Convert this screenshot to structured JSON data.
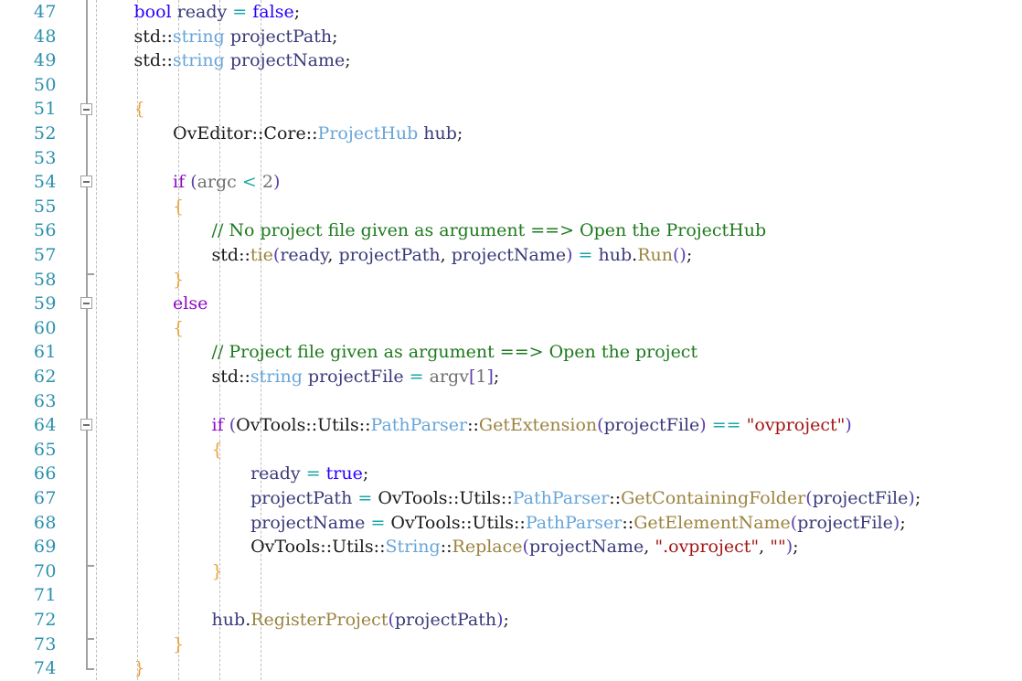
{
  "editor": {
    "name": "code-editor",
    "language": "cpp",
    "background": "#ffffff",
    "first_line": 47,
    "last_line": 74,
    "line_height": 26.6,
    "char_width": 10.63,
    "colors": {
      "line_number": "#2b91af",
      "keyword": "#8f08c4",
      "type": "#2b00ff",
      "class_type": "#68a5d8",
      "function": "#9b8340",
      "comment": "#1d7a1d",
      "string": "#a31515",
      "operator": "#1aa7a7",
      "brace": "#e8a33d",
      "paren": "#5c3fb0",
      "identifier": "#3a3a7a",
      "dim": "#6f6f6f",
      "fold_line": "#a0a0a0",
      "indent_guide": "#bfbfbf"
    }
  },
  "indent_guides_x": [
    105,
    150,
    195,
    240,
    285
  ],
  "lines": [
    {
      "n": 47,
      "indent": 4,
      "fold": "line",
      "tokens": [
        {
          "t": "bool",
          "c": "tok-type"
        },
        {
          "t": " ",
          "c": "tok-plain"
        },
        {
          "t": "ready",
          "c": "tok-id"
        },
        {
          "t": " ",
          "c": "tok-plain"
        },
        {
          "t": "=",
          "c": "tok-op"
        },
        {
          "t": " ",
          "c": "tok-plain"
        },
        {
          "t": "false",
          "c": "tok-type"
        },
        {
          "t": ";",
          "c": "tok-plain"
        }
      ]
    },
    {
      "n": 48,
      "indent": 4,
      "fold": "line",
      "tokens": [
        {
          "t": "std",
          "c": "tok-plain"
        },
        {
          "t": "::",
          "c": "tok-plain"
        },
        {
          "t": "string",
          "c": "tok-class"
        },
        {
          "t": " ",
          "c": "tok-plain"
        },
        {
          "t": "projectPath",
          "c": "tok-id"
        },
        {
          "t": ";",
          "c": "tok-plain"
        }
      ]
    },
    {
      "n": 49,
      "indent": 4,
      "fold": "line",
      "tokens": [
        {
          "t": "std",
          "c": "tok-plain"
        },
        {
          "t": "::",
          "c": "tok-plain"
        },
        {
          "t": "string",
          "c": "tok-class"
        },
        {
          "t": " ",
          "c": "tok-plain"
        },
        {
          "t": "projectName",
          "c": "tok-id"
        },
        {
          "t": ";",
          "c": "tok-plain"
        }
      ]
    },
    {
      "n": 50,
      "indent": 0,
      "fold": "line",
      "tokens": []
    },
    {
      "n": 51,
      "indent": 4,
      "fold": "box",
      "tokens": [
        {
          "t": "{",
          "c": "tok-brace"
        }
      ]
    },
    {
      "n": 52,
      "indent": 8,
      "fold": "line",
      "tokens": [
        {
          "t": "OvEditor",
          "c": "tok-plain"
        },
        {
          "t": "::",
          "c": "tok-plain"
        },
        {
          "t": "Core",
          "c": "tok-plain"
        },
        {
          "t": "::",
          "c": "tok-plain"
        },
        {
          "t": "ProjectHub",
          "c": "tok-class"
        },
        {
          "t": " ",
          "c": "tok-plain"
        },
        {
          "t": "hub",
          "c": "tok-id"
        },
        {
          "t": ";",
          "c": "tok-plain"
        }
      ]
    },
    {
      "n": 53,
      "indent": 0,
      "fold": "line",
      "tokens": []
    },
    {
      "n": 54,
      "indent": 8,
      "fold": "box",
      "tokens": [
        {
          "t": "if",
          "c": "tok-kw"
        },
        {
          "t": " ",
          "c": "tok-plain"
        },
        {
          "t": "(",
          "c": "tok-paren"
        },
        {
          "t": "argc",
          "c": "tok-dim"
        },
        {
          "t": " ",
          "c": "tok-plain"
        },
        {
          "t": "<",
          "c": "tok-op"
        },
        {
          "t": " ",
          "c": "tok-plain"
        },
        {
          "t": "2",
          "c": "tok-dim"
        },
        {
          "t": ")",
          "c": "tok-paren"
        }
      ]
    },
    {
      "n": 55,
      "indent": 8,
      "fold": "line",
      "tokens": [
        {
          "t": "{",
          "c": "tok-brace"
        }
      ]
    },
    {
      "n": 56,
      "indent": 12,
      "fold": "line",
      "tokens": [
        {
          "t": "// No project file given as argument ==> Open the ProjectHub",
          "c": "tok-comment"
        }
      ]
    },
    {
      "n": 57,
      "indent": 12,
      "fold": "line",
      "tokens": [
        {
          "t": "std",
          "c": "tok-plain"
        },
        {
          "t": "::",
          "c": "tok-plain"
        },
        {
          "t": "tie",
          "c": "tok-fn"
        },
        {
          "t": "(",
          "c": "tok-paren"
        },
        {
          "t": "ready",
          "c": "tok-id"
        },
        {
          "t": ", ",
          "c": "tok-plain"
        },
        {
          "t": "projectPath",
          "c": "tok-id"
        },
        {
          "t": ", ",
          "c": "tok-plain"
        },
        {
          "t": "projectName",
          "c": "tok-id"
        },
        {
          "t": ")",
          "c": "tok-paren"
        },
        {
          "t": " ",
          "c": "tok-plain"
        },
        {
          "t": "=",
          "c": "tok-op"
        },
        {
          "t": " ",
          "c": "tok-plain"
        },
        {
          "t": "hub",
          "c": "tok-id"
        },
        {
          "t": ".",
          "c": "tok-plain"
        },
        {
          "t": "Run",
          "c": "tok-fn"
        },
        {
          "t": "(",
          "c": "tok-paren"
        },
        {
          "t": ")",
          "c": "tok-paren"
        },
        {
          "t": ";",
          "c": "tok-plain"
        }
      ]
    },
    {
      "n": 58,
      "indent": 8,
      "fold": "line-endfoot",
      "tokens": [
        {
          "t": "}",
          "c": "tok-brace"
        }
      ]
    },
    {
      "n": 59,
      "indent": 8,
      "fold": "box",
      "tokens": [
        {
          "t": "else",
          "c": "tok-kw"
        }
      ]
    },
    {
      "n": 60,
      "indent": 8,
      "fold": "line",
      "tokens": [
        {
          "t": "{",
          "c": "tok-brace"
        }
      ]
    },
    {
      "n": 61,
      "indent": 12,
      "fold": "line",
      "tokens": [
        {
          "t": "// Project file given as argument ==> Open the project",
          "c": "tok-comment"
        }
      ]
    },
    {
      "n": 62,
      "indent": 12,
      "fold": "line",
      "tokens": [
        {
          "t": "std",
          "c": "tok-plain"
        },
        {
          "t": "::",
          "c": "tok-plain"
        },
        {
          "t": "string",
          "c": "tok-class"
        },
        {
          "t": " ",
          "c": "tok-plain"
        },
        {
          "t": "projectFile",
          "c": "tok-id"
        },
        {
          "t": " ",
          "c": "tok-plain"
        },
        {
          "t": "=",
          "c": "tok-op"
        },
        {
          "t": " ",
          "c": "tok-plain"
        },
        {
          "t": "argv",
          "c": "tok-dim"
        },
        {
          "t": "[",
          "c": "tok-paren"
        },
        {
          "t": "1",
          "c": "tok-dim"
        },
        {
          "t": "]",
          "c": "tok-paren"
        },
        {
          "t": ";",
          "c": "tok-plain"
        }
      ]
    },
    {
      "n": 63,
      "indent": 0,
      "fold": "line",
      "tokens": []
    },
    {
      "n": 64,
      "indent": 12,
      "fold": "box",
      "tokens": [
        {
          "t": "if",
          "c": "tok-kw"
        },
        {
          "t": " ",
          "c": "tok-plain"
        },
        {
          "t": "(",
          "c": "tok-paren"
        },
        {
          "t": "OvTools",
          "c": "tok-plain"
        },
        {
          "t": "::",
          "c": "tok-plain"
        },
        {
          "t": "Utils",
          "c": "tok-plain"
        },
        {
          "t": "::",
          "c": "tok-plain"
        },
        {
          "t": "PathParser",
          "c": "tok-class"
        },
        {
          "t": "::",
          "c": "tok-plain"
        },
        {
          "t": "GetExtension",
          "c": "tok-fn"
        },
        {
          "t": "(",
          "c": "tok-paren"
        },
        {
          "t": "projectFile",
          "c": "tok-id"
        },
        {
          "t": ")",
          "c": "tok-paren"
        },
        {
          "t": " ",
          "c": "tok-plain"
        },
        {
          "t": "==",
          "c": "tok-op"
        },
        {
          "t": " ",
          "c": "tok-plain"
        },
        {
          "t": "\"ovproject\"",
          "c": "tok-str"
        },
        {
          "t": ")",
          "c": "tok-paren"
        }
      ]
    },
    {
      "n": 65,
      "indent": 12,
      "fold": "line",
      "tokens": [
        {
          "t": "{",
          "c": "tok-brace"
        }
      ]
    },
    {
      "n": 66,
      "indent": 16,
      "fold": "line",
      "tokens": [
        {
          "t": "ready",
          "c": "tok-id"
        },
        {
          "t": " ",
          "c": "tok-plain"
        },
        {
          "t": "=",
          "c": "tok-op"
        },
        {
          "t": " ",
          "c": "tok-plain"
        },
        {
          "t": "true",
          "c": "tok-type"
        },
        {
          "t": ";",
          "c": "tok-plain"
        }
      ]
    },
    {
      "n": 67,
      "indent": 16,
      "fold": "line",
      "tokens": [
        {
          "t": "projectPath",
          "c": "tok-id"
        },
        {
          "t": " ",
          "c": "tok-plain"
        },
        {
          "t": "=",
          "c": "tok-op"
        },
        {
          "t": " ",
          "c": "tok-plain"
        },
        {
          "t": "OvTools",
          "c": "tok-plain"
        },
        {
          "t": "::",
          "c": "tok-plain"
        },
        {
          "t": "Utils",
          "c": "tok-plain"
        },
        {
          "t": "::",
          "c": "tok-plain"
        },
        {
          "t": "PathParser",
          "c": "tok-class"
        },
        {
          "t": "::",
          "c": "tok-plain"
        },
        {
          "t": "GetContainingFolder",
          "c": "tok-fn"
        },
        {
          "t": "(",
          "c": "tok-paren"
        },
        {
          "t": "projectFile",
          "c": "tok-id"
        },
        {
          "t": ")",
          "c": "tok-paren"
        },
        {
          "t": ";",
          "c": "tok-plain"
        }
      ]
    },
    {
      "n": 68,
      "indent": 16,
      "fold": "line",
      "tokens": [
        {
          "t": "projectName",
          "c": "tok-id"
        },
        {
          "t": " ",
          "c": "tok-plain"
        },
        {
          "t": "=",
          "c": "tok-op"
        },
        {
          "t": " ",
          "c": "tok-plain"
        },
        {
          "t": "OvTools",
          "c": "tok-plain"
        },
        {
          "t": "::",
          "c": "tok-plain"
        },
        {
          "t": "Utils",
          "c": "tok-plain"
        },
        {
          "t": "::",
          "c": "tok-plain"
        },
        {
          "t": "PathParser",
          "c": "tok-class"
        },
        {
          "t": "::",
          "c": "tok-plain"
        },
        {
          "t": "GetElementName",
          "c": "tok-fn"
        },
        {
          "t": "(",
          "c": "tok-paren"
        },
        {
          "t": "projectFile",
          "c": "tok-id"
        },
        {
          "t": ")",
          "c": "tok-paren"
        },
        {
          "t": ";",
          "c": "tok-plain"
        }
      ]
    },
    {
      "n": 69,
      "indent": 16,
      "fold": "line",
      "tokens": [
        {
          "t": "OvTools",
          "c": "tok-plain"
        },
        {
          "t": "::",
          "c": "tok-plain"
        },
        {
          "t": "Utils",
          "c": "tok-plain"
        },
        {
          "t": "::",
          "c": "tok-plain"
        },
        {
          "t": "String",
          "c": "tok-class"
        },
        {
          "t": "::",
          "c": "tok-plain"
        },
        {
          "t": "Replace",
          "c": "tok-fn"
        },
        {
          "t": "(",
          "c": "tok-paren"
        },
        {
          "t": "projectName",
          "c": "tok-id"
        },
        {
          "t": ", ",
          "c": "tok-plain"
        },
        {
          "t": "\".ovproject\"",
          "c": "tok-str"
        },
        {
          "t": ", ",
          "c": "tok-plain"
        },
        {
          "t": "\"\"",
          "c": "tok-str"
        },
        {
          "t": ")",
          "c": "tok-paren"
        },
        {
          "t": ";",
          "c": "tok-plain"
        }
      ]
    },
    {
      "n": 70,
      "indent": 12,
      "fold": "line-endfoot",
      "tokens": [
        {
          "t": "}",
          "c": "tok-brace"
        }
      ]
    },
    {
      "n": 71,
      "indent": 0,
      "fold": "line",
      "tokens": []
    },
    {
      "n": 72,
      "indent": 12,
      "fold": "line",
      "tokens": [
        {
          "t": "hub",
          "c": "tok-id"
        },
        {
          "t": ".",
          "c": "tok-plain"
        },
        {
          "t": "RegisterProject",
          "c": "tok-fn"
        },
        {
          "t": "(",
          "c": "tok-paren"
        },
        {
          "t": "projectPath",
          "c": "tok-id"
        },
        {
          "t": ")",
          "c": "tok-paren"
        },
        {
          "t": ";",
          "c": "tok-plain"
        }
      ]
    },
    {
      "n": 73,
      "indent": 8,
      "fold": "line-endfoot",
      "tokens": [
        {
          "t": "}",
          "c": "tok-brace"
        }
      ]
    },
    {
      "n": 74,
      "indent": 4,
      "fold": "half-top-endfoot",
      "tokens": [
        {
          "t": "}",
          "c": "tok-brace"
        }
      ]
    }
  ]
}
